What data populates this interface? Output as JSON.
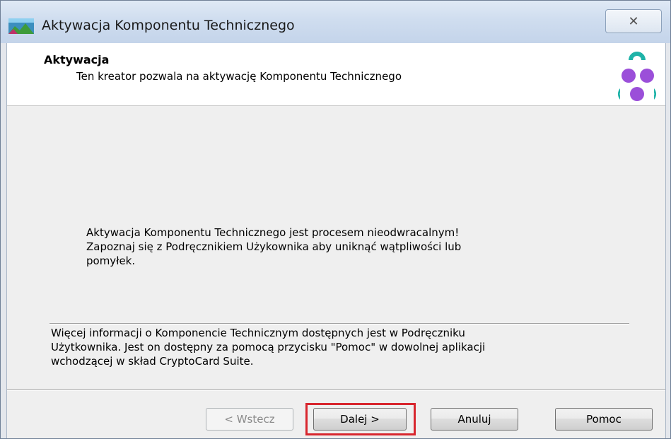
{
  "window": {
    "title": "Aktywacja Komponentu Technicznego",
    "close_symbol": "✕"
  },
  "header": {
    "title": "Aktywacja",
    "subtitle": "Ten kreator pozwala na aktywację Komponentu Technicznego",
    "logo_icon": "three-dots-logo-icon"
  },
  "body": {
    "warning_lines": [
      "Aktywacja Komponentu Technicznego jest procesem nieodwracalnym!",
      "Zapoznaj się z Podręcznikiem Użykownika aby uniknąć wątpliwości lub",
      "pomyłek."
    ],
    "info_lines": [
      "Więcej informacji o Komponencie Technicznym dostępnych jest w Podręczniku",
      "Użytkownika. Jest on dostępny za pomocą przycisku \"Pomoc\" w dowolnej aplikacji",
      "wchodzącej w skład CryptoCard Suite."
    ]
  },
  "buttons": {
    "back": "< Wstecz",
    "next": "Dalej >",
    "cancel": "Anuluj",
    "help": "Pomoc"
  },
  "colors": {
    "highlight": "#d8262e",
    "logo_purple": "#9b4fd9",
    "logo_teal": "#1fb3a8"
  }
}
